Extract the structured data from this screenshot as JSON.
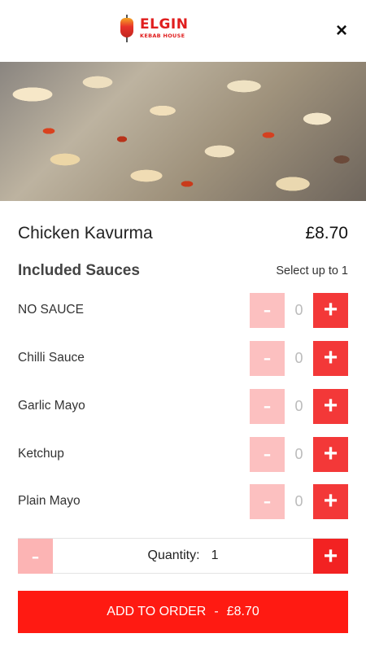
{
  "header": {
    "logo_brand": "ELGIN",
    "logo_sub": "KEBAB HOUSE",
    "close_icon": "×"
  },
  "item": {
    "name": "Chicken Kavurma",
    "price": "£8.70",
    "photo": "food-photo"
  },
  "sauces": {
    "title": "Included Sauces",
    "limit": "Select up to 1",
    "options": [
      {
        "label": "NO SAUCE",
        "count": "0"
      },
      {
        "label": "Chilli Sauce",
        "count": "0"
      },
      {
        "label": "Garlic Mayo",
        "count": "0"
      },
      {
        "label": "Ketchup",
        "count": "0"
      },
      {
        "label": "Plain Mayo",
        "count": "0"
      }
    ],
    "minus": "-",
    "plus": "+"
  },
  "quantity": {
    "label": "Quantity:",
    "value": "1",
    "minus": "-",
    "plus": "+"
  },
  "add_button": {
    "label": "ADD TO ORDER",
    "separator": "-",
    "price": "£8.70"
  },
  "colors": {
    "accent": "#ff1a12",
    "plus": "#f33838",
    "minus_disabled": "#fcc0c0"
  }
}
